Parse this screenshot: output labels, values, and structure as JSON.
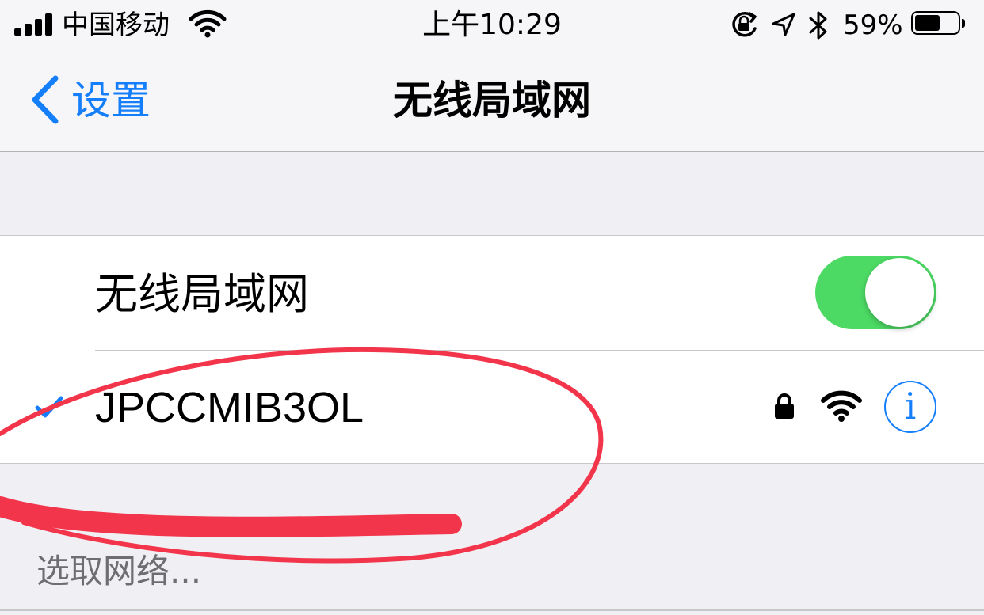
{
  "status_bar": {
    "carrier": "中国移动",
    "time": "上午10:29",
    "battery_percent": "59%",
    "battery_level": 0.59,
    "icons": [
      "signal-icon",
      "wifi-icon",
      "rotation-lock-icon",
      "location-arrow-icon",
      "bluetooth-icon",
      "battery-icon"
    ]
  },
  "nav": {
    "back_label": "设置",
    "title": "无线局域网"
  },
  "wifi_toggle": {
    "label": "无线局域网",
    "on": true,
    "on_color": "#4cd964"
  },
  "connected_network": {
    "name": "JPCCMIB3OL",
    "selected": true,
    "secured": true,
    "info_glyph": "i"
  },
  "networks_section": {
    "header": "选取网络..."
  },
  "colors": {
    "accent": "#157efb",
    "annotation": "#f2354a",
    "background": "#efeff4"
  }
}
